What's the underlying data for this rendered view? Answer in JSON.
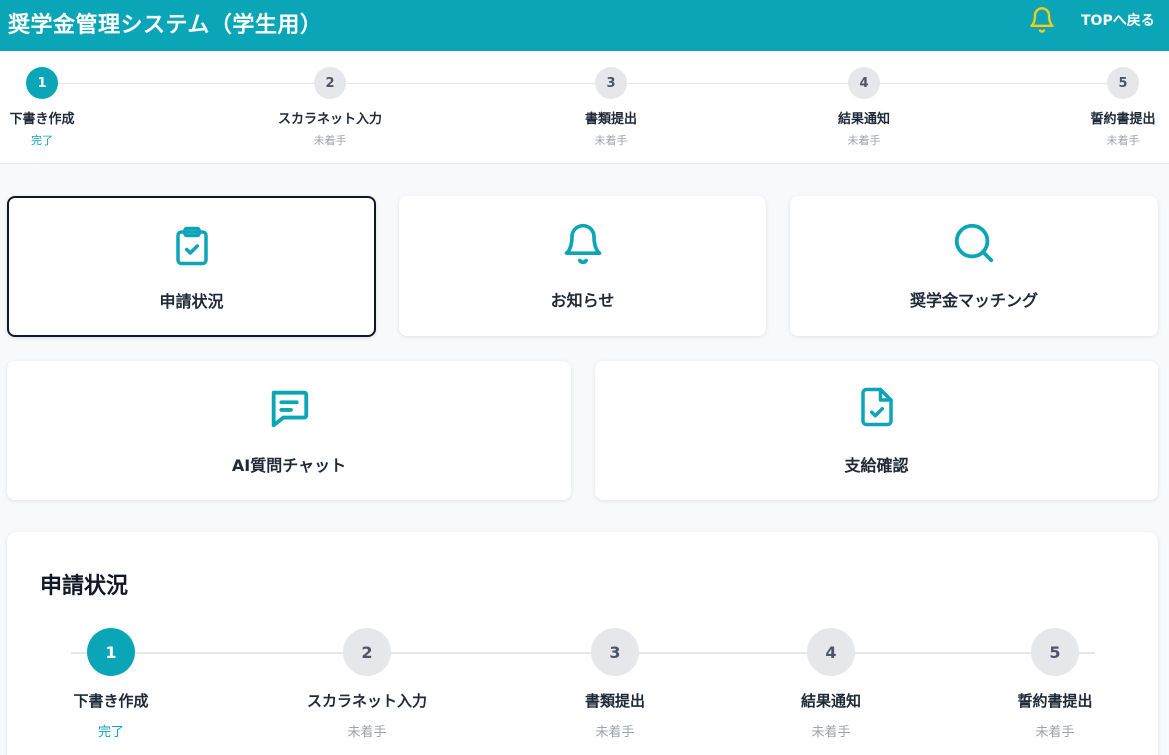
{
  "header": {
    "title": "奨学金管理システム（学生用）",
    "back_link": "TOPへ戻る",
    "bell_icon": "bell-icon",
    "accent_color": "#0aa6b8",
    "bell_color": "#facc15"
  },
  "steps": [
    {
      "number": "1",
      "label": "下書き作成",
      "status": "完了"
    },
    {
      "number": "2",
      "label": "スカラネット入力",
      "status": "未着手"
    },
    {
      "number": "3",
      "label": "書類提出",
      "status": "未着手"
    },
    {
      "number": "4",
      "label": "結果通知",
      "status": "未着手"
    },
    {
      "number": "5",
      "label": "誓約書提出",
      "status": "未着手"
    }
  ],
  "cards": [
    {
      "label": "申請状況",
      "icon": "clipboard-check-icon",
      "active": true
    },
    {
      "label": "お知らせ",
      "icon": "bell-icon",
      "active": false
    },
    {
      "label": "奨学金マッチング",
      "icon": "search-icon",
      "active": false
    },
    {
      "label": "AI質問チャット",
      "icon": "chat-icon",
      "active": false
    },
    {
      "label": "支給確認",
      "icon": "document-check-icon",
      "active": false
    }
  ],
  "status_panel": {
    "title": "申請状況"
  }
}
